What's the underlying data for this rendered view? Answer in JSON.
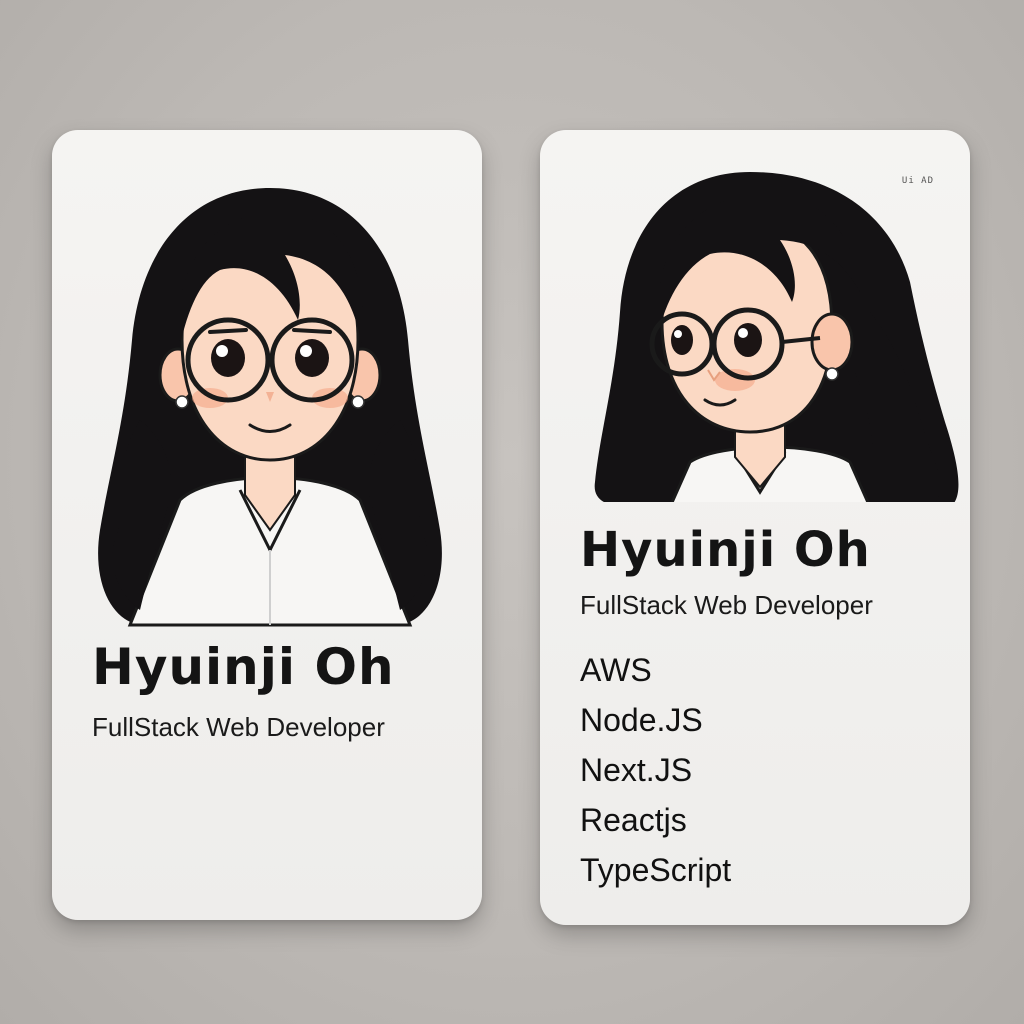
{
  "cards": {
    "front": {
      "name": "Hyuinji Oh",
      "role": "FullStack Web Developer"
    },
    "back": {
      "name": "Hyuinji Oh",
      "role": "FullStack Web Developer",
      "corner_mark": "Ui AD",
      "skills": [
        "AWS",
        "Node.JS",
        "Next.JS",
        "Reactjs",
        "TypeScript"
      ]
    }
  },
  "colors": {
    "background": "#bcb8b4",
    "card": "#f3f2f0",
    "hair": "#141214",
    "skin": "#fbd9c4",
    "cheek": "#f5a585",
    "text": "#141414"
  },
  "icons": {
    "front_portrait": "avatar-front-facing",
    "back_portrait": "avatar-side-profile"
  }
}
